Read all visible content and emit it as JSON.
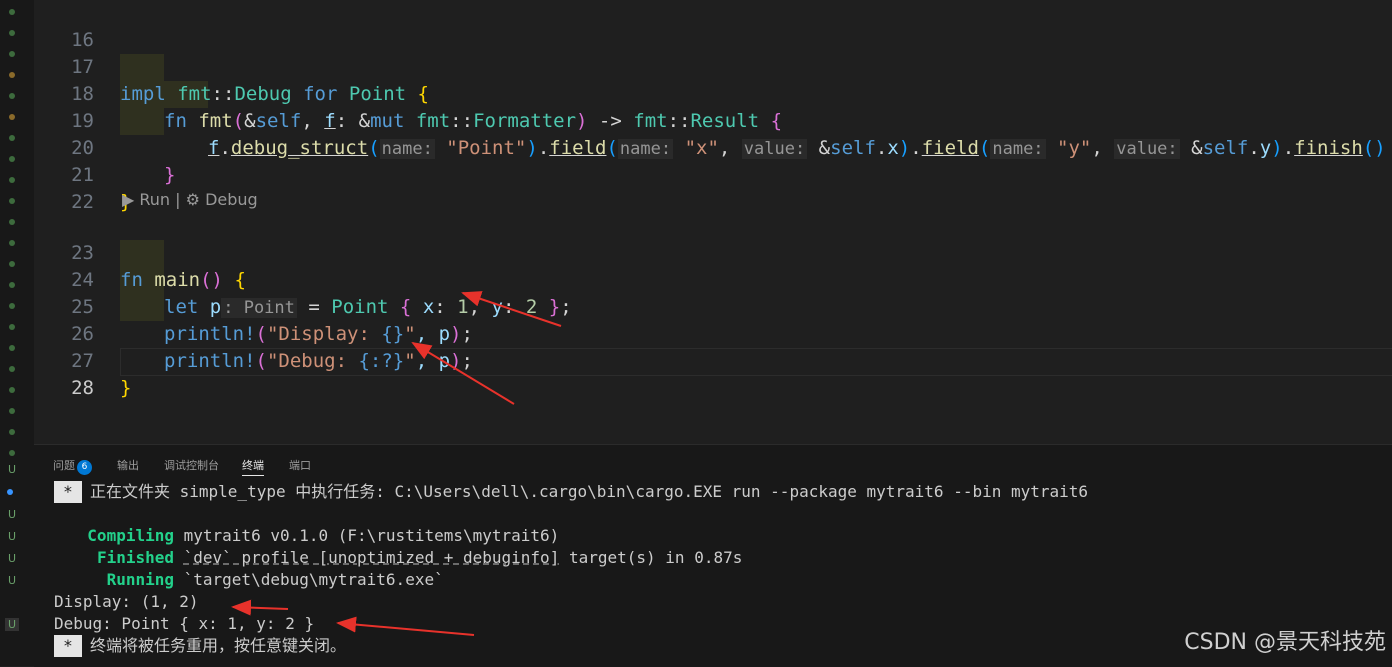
{
  "editor": {
    "line_numbers": [
      "16",
      "17",
      "18",
      "19",
      "20",
      "21",
      "22",
      "23",
      "24",
      "25",
      "26",
      "27",
      "28"
    ],
    "codelens": "▶ Run | ⚙ Debug",
    "code": {
      "l17": {
        "impl": "impl",
        "fmt": "fmt",
        "sep": "::",
        "debug": "Debug",
        "for": "for",
        "point": "Point",
        "brace": "{"
      },
      "l18": {
        "fn": "fn",
        "name": "fmt",
        "open": "(",
        "amp": "&",
        "self": "self",
        "comma": ",",
        "f": "f",
        "colon": ":",
        "ampmut": "&",
        "mut": "mut",
        "fmt": "fmt",
        "sep": "::",
        "formatter": "Formatter",
        "close": ")",
        "arrow": "->",
        "fmt2": "fmt",
        "sep2": "::",
        "result": "Result",
        "brace": "{"
      },
      "l19": {
        "f": "f",
        "dot": ".",
        "debug_struct": "debug_struct",
        "p1": "(",
        "h1": "name:",
        "s1": "\"Point\"",
        "p2": ")",
        "dot2": ".",
        "field1": "field",
        "p3": "(",
        "h2": "name:",
        "s2": "\"x\"",
        "comma1": ",",
        "h3": "value:",
        "amp1": "&",
        "self1": "self",
        "dot3": ".",
        "x": "x",
        "p4": ")",
        "dot4": ".",
        "field2": "field",
        "p5": "(",
        "h4": "name:",
        "s3": "\"y\"",
        "comma2": ",",
        "h5": "value:",
        "amp2": "&",
        "self2": "self",
        "dot5": ".",
        "y": "y",
        "p6": ")",
        "dot6": ".",
        "finish": "finish",
        "p7": "()"
      },
      "l20": {
        "brace": "}"
      },
      "l21": {
        "brace": "}"
      },
      "l23": {
        "fn": "fn",
        "main": "main",
        "parens": "()",
        "brace": "{"
      },
      "l24": {
        "let": "let",
        "p": "p",
        "hint": ": Point",
        "eq": "=",
        "point": "Point",
        "ob": "{",
        "x": "x",
        "c1": ":",
        "one": "1",
        "comma": ",",
        "y": "y",
        "c2": ":",
        "two": "2",
        "cb": "}",
        "semi": ";"
      },
      "l25": {
        "mac": "println!",
        "open": "(",
        "s1": "\"Display: ",
        "ph": "{}",
        "s2": "\"",
        "rest": ", p",
        "close": ")",
        "semi": ";"
      },
      "l26": {
        "mac": "println!",
        "open": "(",
        "s1": "\"Debug: ",
        "ph": "{:?}",
        "s2": "\"",
        "rest": ", p",
        "close": ")",
        "semi": ";"
      },
      "l27": {
        "brace": "}"
      }
    }
  },
  "panel": {
    "tabs": [
      {
        "label": "问题",
        "badge": "6"
      },
      {
        "label": "输出"
      },
      {
        "label": "调试控制台"
      },
      {
        "label": "终端",
        "active": true
      },
      {
        "label": "端口"
      }
    ],
    "terminal": {
      "star": "*",
      "task_line": "正在文件夹 simple_type 中执行任务: C:\\Users\\dell\\.cargo\\bin\\cargo.EXE run --package mytrait6 --bin mytrait6",
      "compiling_label": "Compiling",
      "compiling_text": " mytrait6 v0.1.0 (F:\\rustitems\\mytrait6)",
      "finished_label": "Finished",
      "finished_text_a": " ",
      "finished_profile": "`dev` profile [unoptimized + debuginfo]",
      "finished_text_b": " target(s) in 0.87s",
      "running_label": "Running",
      "running_text": " `target\\debug\\mytrait6.exe`",
      "display_out": "Display: (1, 2)",
      "debug_out": "Debug: Point { x: 1, y: 2 }",
      "close_msg": "终端将被任务重用，按任意键关闭。"
    }
  },
  "gutter": {
    "u_marks": [
      "U",
      "U",
      "U",
      "U",
      "U",
      "U"
    ]
  },
  "watermark": "CSDN @景天科技苑",
  "colors": {
    "arrow": "#e8322b",
    "background": "#1f1f1f",
    "panel": "#181818"
  }
}
